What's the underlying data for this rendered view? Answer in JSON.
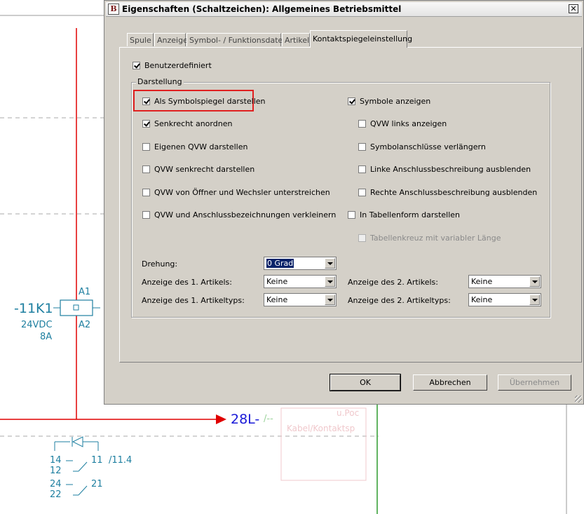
{
  "dialog": {
    "title": "Eigenschaften (Schaltzeichen): Allgemeines Betriebsmittel",
    "close_glyph": "✕",
    "icon_glyph": "B",
    "tabs": [
      {
        "label": "Spule"
      },
      {
        "label": "Anzeige"
      },
      {
        "label": "Symbol- / Funktionsdaten"
      },
      {
        "label": "Artikel"
      },
      {
        "label": "Kontaktspiegeleinstellung",
        "active": true
      }
    ],
    "benutzerdefiniert": {
      "label": "Benutzerdefiniert",
      "checked": true
    },
    "group_title": "Darstellung",
    "left_options": [
      {
        "label": "Als Symbolspiegel darstellen",
        "checked": true,
        "highlighted": true
      },
      {
        "label": "Senkrecht anordnen",
        "checked": true
      },
      {
        "label": "Eigenen QVW darstellen",
        "checked": false
      },
      {
        "label": "QVW senkrecht darstellen",
        "checked": false
      },
      {
        "label": "QVW von Öffner und Wechsler unterstreichen",
        "checked": false
      },
      {
        "label": "QVW und Anschlussbezeichnungen verkleinern",
        "checked": false
      }
    ],
    "right_options": [
      {
        "label": "Symbole anzeigen",
        "checked": true
      },
      {
        "label": "QVW links anzeigen",
        "checked": false
      },
      {
        "label": "Symbolanschlüsse verlängern",
        "checked": false
      },
      {
        "label": "Linke Anschlussbeschreibung ausblenden",
        "checked": false
      },
      {
        "label": "Rechte Anschlussbeschreibung ausblenden",
        "checked": false
      },
      {
        "label": "In Tabellenform darstellen",
        "checked": false
      },
      {
        "label": "Tabellenkreuz mit variabler Länge",
        "checked": false,
        "disabled": true
      }
    ],
    "fields": {
      "drehung": {
        "label": "Drehung:",
        "value": "0 Grad"
      },
      "anzeige_artikel_1": {
        "label": "Anzeige des 1. Artikels:",
        "value": "Keine"
      },
      "anzeige_artikeltyp_1": {
        "label": "Anzeige des 1. Artikeltyps:",
        "value": "Keine"
      },
      "anzeige_artikel_2": {
        "label": "Anzeige des 2. Artikels:",
        "value": "Keine"
      },
      "anzeige_artikeltyp_2": {
        "label": "Anzeige des 2. Artikeltyps:",
        "value": "Keine"
      }
    },
    "buttons": {
      "ok": "OK",
      "cancel": "Abbrechen",
      "apply": "Übernehmen"
    }
  },
  "schematic": {
    "device_tag": "-11K1",
    "coil_top": "A1",
    "coil_bottom": "A2",
    "voltage": "24VDC",
    "current": "8A",
    "potential_label": "28L-",
    "potential_slash": "/--",
    "faded_label_1": "u.Poc",
    "faded_label_2": "Kabel/Kontaktsp",
    "contact_1_left": "14",
    "contact_1_right": "11",
    "contact_1_ref": "/11.4",
    "contact_1_bottom": "12",
    "contact_2_left": "24",
    "contact_2_right": "21",
    "contact_2_bottom": "22",
    "colors": {
      "wire": "#e00000",
      "cad": "#1e7fa0",
      "potential": "#1a1ad8",
      "green": "#2e9b2e"
    }
  }
}
